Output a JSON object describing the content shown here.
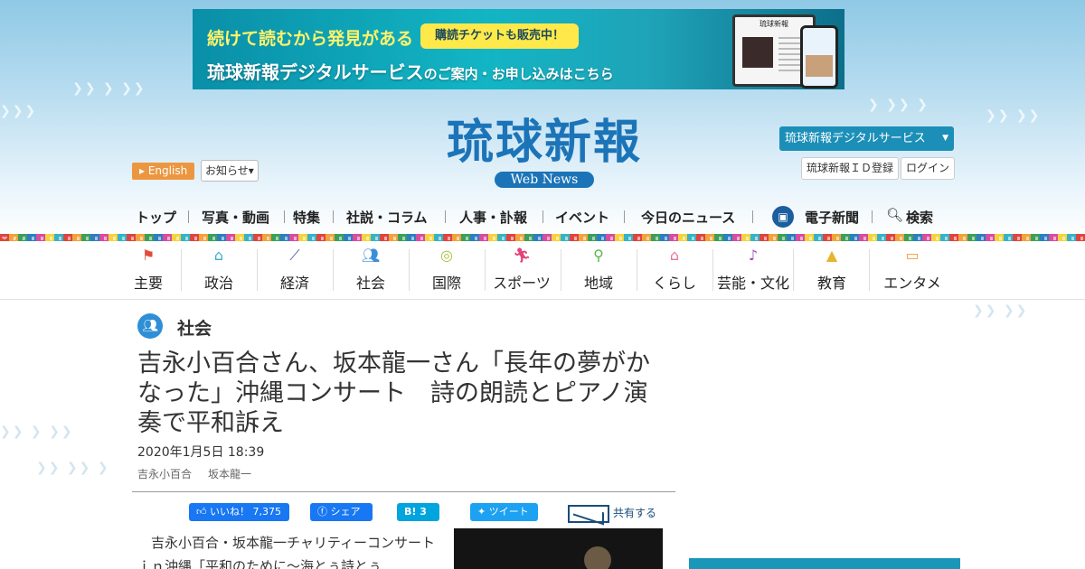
{
  "banner": {
    "catch": "続けて読むから発見がある",
    "pill": "購読チケットも販売中！",
    "main_1": "琉球新報デジタルサービス",
    "main_2": "のご案内・お申し込み",
    "main_3": "はこちら",
    "device_title": "琉球新報"
  },
  "header": {
    "logo": "琉球新報",
    "logo_sub": "Web News",
    "english": "English",
    "notice": "お知らせ",
    "digital_service": "琉球新報デジタルサービス",
    "id_register": "琉球新報ＩＤ登録",
    "login": "ログイン"
  },
  "gnav": {
    "items": [
      "トップ",
      "写真・動画",
      "特集",
      "社説・コラム",
      "人事・訃報",
      "イベント",
      "今日のニュース",
      "電子新聞",
      "検索"
    ]
  },
  "categories": {
    "items": [
      {
        "label": "主要",
        "icon": "flag-icon",
        "color": "#e24b3b"
      },
      {
        "label": "政治",
        "icon": "government-building-icon",
        "color": "#3ab0c8"
      },
      {
        "label": "経済",
        "icon": "chart-line-icon",
        "color": "#4a5aa8"
      },
      {
        "label": "社会",
        "icon": "people-icon",
        "color": "#3b8fd8"
      },
      {
        "label": "国際",
        "icon": "globe-icon",
        "color": "#a7c43b"
      },
      {
        "label": "スポーツ",
        "icon": "runner-icon",
        "color": "#e0457a"
      },
      {
        "label": "地域",
        "icon": "map-pin-icon",
        "color": "#5bb34a"
      },
      {
        "label": "くらし",
        "icon": "house-icon",
        "color": "#e9739a"
      },
      {
        "label": "芸能・文化",
        "icon": "sanshin-icon",
        "color": "#9b4fbf"
      },
      {
        "label": "教育",
        "icon": "mortarboard-icon",
        "color": "#e7b52b"
      },
      {
        "label": "エンタメ",
        "icon": "tv-icon",
        "color": "#f0a030"
      }
    ]
  },
  "article": {
    "section": "社会",
    "headline": "吉永小百合さん、坂本龍一さん「長年の夢がかなった」沖縄コンサート　詩の朗読とピアノ演奏で平和訴え",
    "date": "2020年1月5日 18:39",
    "tags": [
      "吉永小百合",
      "坂本龍一"
    ],
    "body": "　吉永小百合・坂本龍一チャリティーコンサートｉｎ沖縄「平和のために～海とぅ詩とぅ"
  },
  "share": {
    "like": "いいね！ 7,375",
    "share": "シェア",
    "hatena": "B! 3",
    "tweet": "ツイート",
    "all": "共有する"
  }
}
